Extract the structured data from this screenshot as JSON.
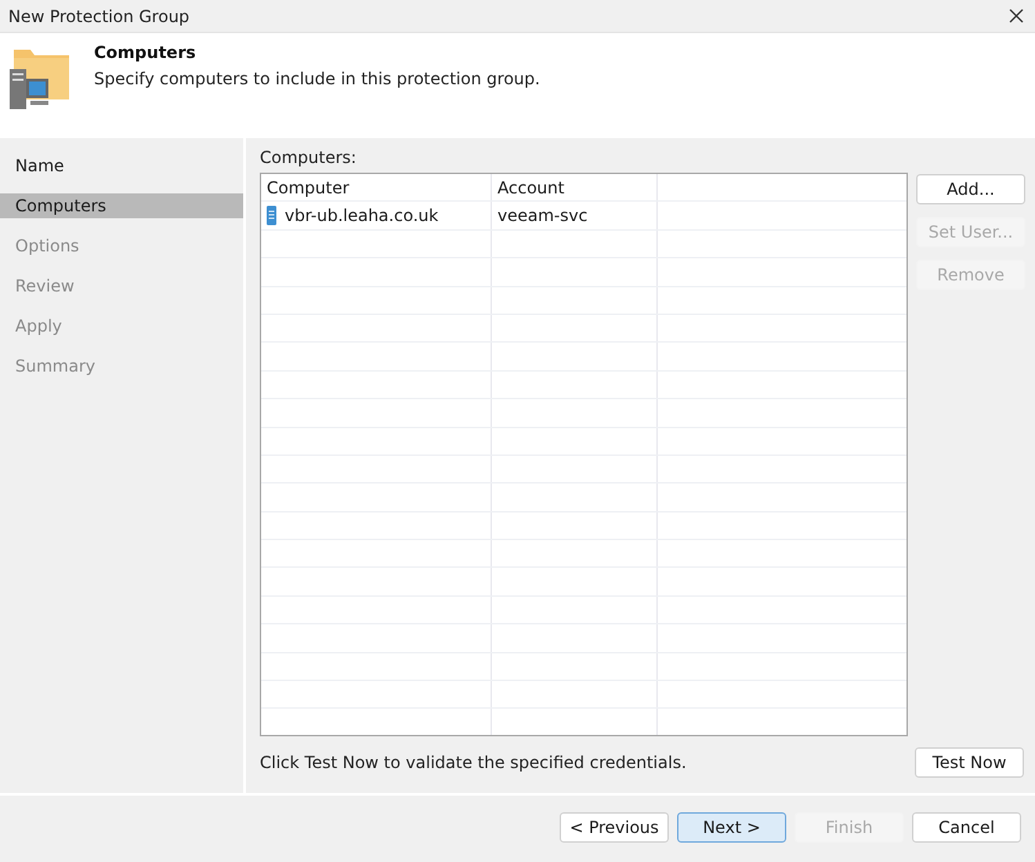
{
  "window": {
    "title": "New Protection Group"
  },
  "header": {
    "title": "Computers",
    "description": "Specify computers to include in this protection group."
  },
  "steps": [
    {
      "label": "Name",
      "selected": false,
      "disabled": false
    },
    {
      "label": "Computers",
      "selected": true,
      "disabled": false
    },
    {
      "label": "Options",
      "selected": false,
      "disabled": true
    },
    {
      "label": "Review",
      "selected": false,
      "disabled": true
    },
    {
      "label": "Apply",
      "selected": false,
      "disabled": true
    },
    {
      "label": "Summary",
      "selected": false,
      "disabled": true
    }
  ],
  "computers_label": "Computers:",
  "table": {
    "columns": [
      "Computer",
      "Account"
    ],
    "rows": [
      {
        "computer": "vbr-ub.leaha.co.uk",
        "account": "veeam-svc"
      }
    ]
  },
  "side_buttons": [
    {
      "label": "Add...",
      "disabled": false
    },
    {
      "label": "Set User...",
      "disabled": true
    },
    {
      "label": "Remove",
      "disabled": true
    }
  ],
  "hint": "Click Test Now to validate the specified credentials.",
  "test_button": {
    "label": "Test Now",
    "disabled": false
  },
  "footer_buttons": [
    {
      "label": "< Previous",
      "disabled": false,
      "default": false
    },
    {
      "label": "Next >",
      "disabled": false,
      "default": true
    },
    {
      "label": "Finish",
      "disabled": true,
      "default": false
    },
    {
      "label": "Cancel",
      "disabled": false,
      "default": false
    }
  ]
}
